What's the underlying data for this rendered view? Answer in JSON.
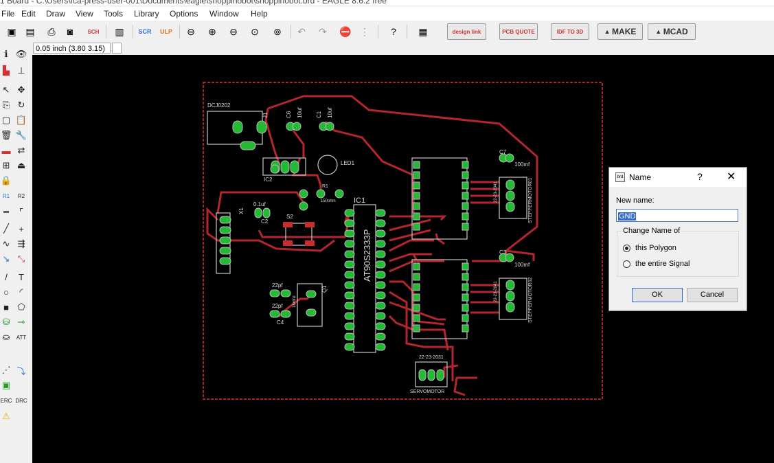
{
  "window": {
    "title": "1 Board - C:\\Users\\fca-press-user-001\\Documents\\eagle\\shoppinobot\\shoppinobot.brd - EAGLE 8.6.2 free"
  },
  "menu": [
    "File",
    "Edit",
    "Draw",
    "View",
    "Tools",
    "Library",
    "Options",
    "Window",
    "Help"
  ],
  "toolbar": {
    "buttons": [
      {
        "name": "grid-icon",
        "glyph": "▦"
      },
      {
        "name": "save-icon",
        "glyph": "💾"
      }
    ],
    "design_link_label": "design link",
    "pcb_quote_label": "PCB QUOTE",
    "idf_label": "IDF TO 3D",
    "make_label": "MAKE",
    "mcad_label": "MCAD"
  },
  "coordinate_readout": "0.05 inch (3.80 3.15)",
  "board": {
    "labels": {
      "dcj": "DCJ0202",
      "j1": "J1",
      "c6": "C6",
      "c6_val": "10uf",
      "c1": "C1",
      "c1_val": "10uf",
      "ic2": "IC2",
      "led1": "LED1",
      "r1": "R1",
      "r1_val": "150ohm",
      "c2_val": "0.1uf",
      "c2": "C2",
      "x1": "X1",
      "s2": "S2",
      "ic1": "IC1",
      "ic1_part": "AT90S2333P",
      "c7": "C7",
      "c7_val": "100mf",
      "c3": "C3",
      "c3_val": "100mf",
      "sm1": "STEPPERMOTOR01",
      "sm1_conn": "22-23-2041",
      "sm2": "STEPPERMOTOR02",
      "sm2_conn": "22-23-2041",
      "c5_val": "22pf",
      "c4_val": "22pf",
      "c4": "C4",
      "q1": "Q1",
      "q1_val": "16mhz",
      "servo_conn": "22-23-2031",
      "servo": "SERVOMOTOR"
    }
  },
  "dialog": {
    "title": "Name",
    "help": "?",
    "close": "✕",
    "new_name_label": "New name:",
    "new_name_value": "GND",
    "group_label": "Change Name of",
    "option1": "this Polygon",
    "option2": "the entire Signal",
    "ok": "OK",
    "cancel": "Cancel"
  },
  "colors": {
    "canvas": "#000000",
    "trace": "#b3262e",
    "pad": "#22bb33",
    "outline": "#c8c8c8",
    "board_edge": "#e03030"
  }
}
